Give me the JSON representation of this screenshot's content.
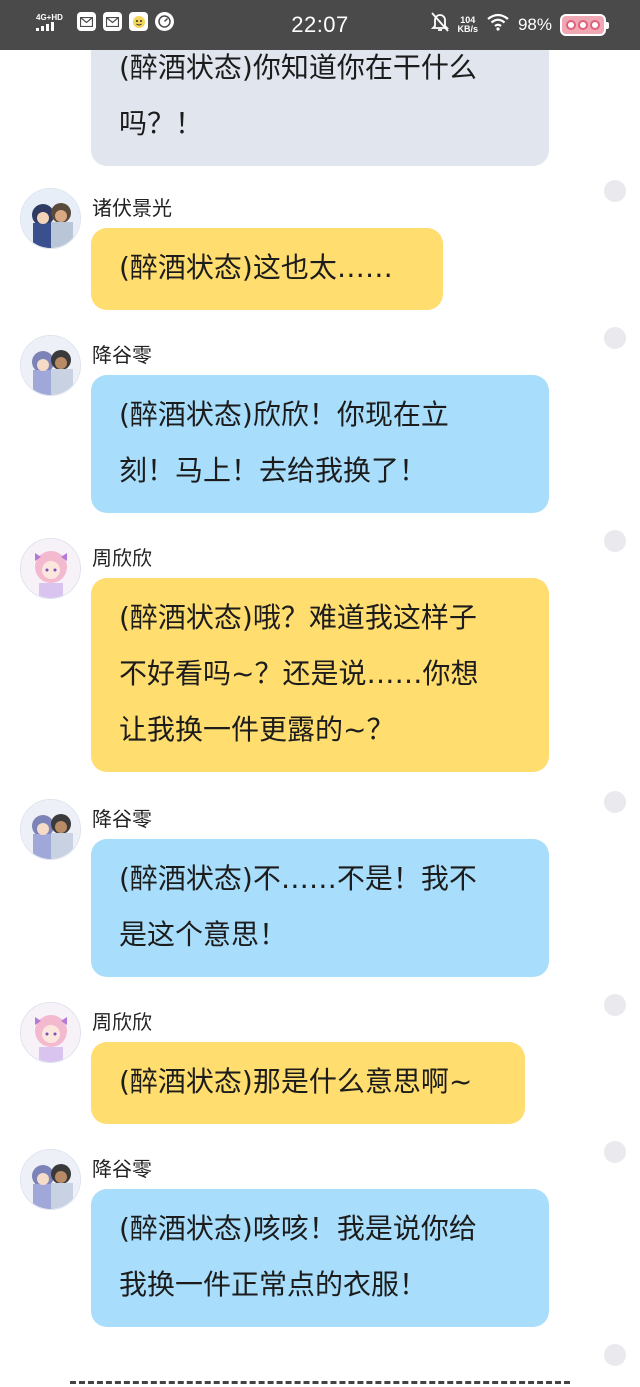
{
  "status_bar": {
    "network": "4G+HD",
    "time": "22:07",
    "speed_value": "104",
    "speed_unit": "KB/s",
    "battery_percent": "98%",
    "background": "#4a4a4a"
  },
  "colors": {
    "yellow_bubble": "#ffdd6e",
    "blue_bubble": "#a8ddfb",
    "gray_bubble": "#e0e5ee"
  },
  "messages": [
    {
      "speaker": "",
      "lines": [
        "(醉酒状态)你知道你在干什么",
        "吗？！"
      ],
      "color": "gray"
    },
    {
      "speaker": "诸伏景光",
      "lines": [
        "(醉酒状态)这也太……"
      ],
      "color": "yellow"
    },
    {
      "speaker": "降谷零",
      "lines": [
        "(醉酒状态)欣欣！你现在立",
        "刻！马上！去给我换了！"
      ],
      "color": "blue"
    },
    {
      "speaker": "周欣欣",
      "lines": [
        "(醉酒状态)哦？难道我这样子",
        "不好看吗~？还是说……你想",
        "让我换一件更露的~？"
      ],
      "color": "yellow"
    },
    {
      "speaker": "降谷零",
      "lines": [
        "(醉酒状态)不……不是！我不",
        "是这个意思！"
      ],
      "color": "blue"
    },
    {
      "speaker": "周欣欣",
      "lines": [
        "(醉酒状态)那是什么意思啊~"
      ],
      "color": "yellow"
    },
    {
      "speaker": "降谷零",
      "lines": [
        "(醉酒状态)咳咳！我是说你给",
        "我换一件正常点的衣服！"
      ],
      "color": "blue"
    }
  ]
}
